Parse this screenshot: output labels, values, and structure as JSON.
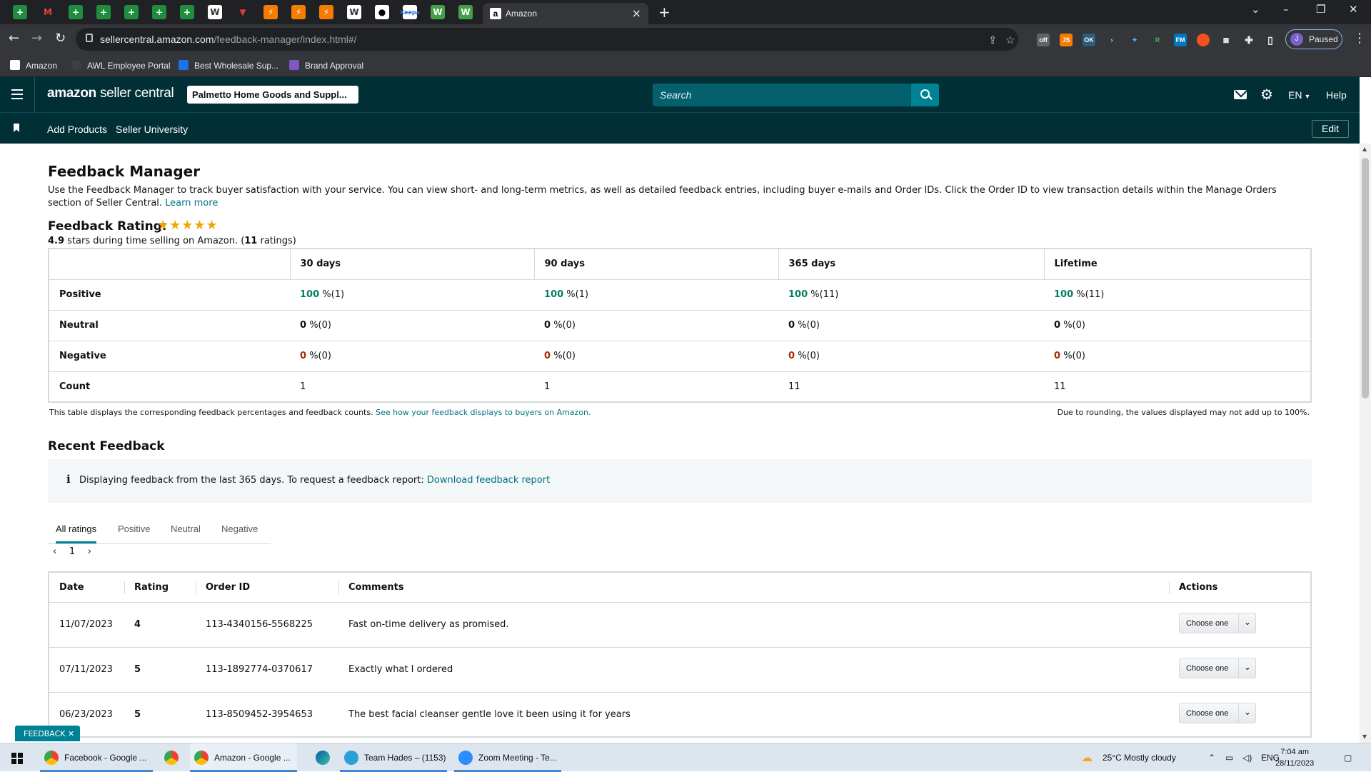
{
  "browser": {
    "active_tab_title": "Amazon",
    "url_host": "sellercentral.amazon.com",
    "url_path": "/feedback-manager/index.html#/",
    "profile_status": "Paused",
    "profile_initial": "J",
    "bookmarks": [
      "Amazon",
      "AWL Employee Portal",
      "Best Wholesale Sup...",
      "Brand Approval"
    ]
  },
  "header": {
    "logo_main": "amazon",
    "logo_sub": "seller central",
    "account": "Palmetto Home Goods and Suppl...",
    "search_placeholder": "Search",
    "language": "EN",
    "help": "Help"
  },
  "subnav": {
    "links": [
      "Add Products",
      "Seller University"
    ],
    "edit": "Edit"
  },
  "page": {
    "title": "Feedback Manager",
    "intro": "Use the Feedback Manager to track buyer satisfaction with your service. You can view short- and long-term metrics, as well as detailed feedback entries, including buyer e-mails and Order IDs. Click the Order ID to view transaction details within the Manage Orders section of Seller Central.",
    "learn_more": "Learn more",
    "rating_title": "Feedback Rating:",
    "rating_stars": "★★★★★",
    "rating_score": "4.9",
    "rating_sub_a": "stars during time selling on Amazon. (",
    "rating_count": "11",
    "rating_sub_b": "ratings)"
  },
  "summary": {
    "columns": [
      "30 days",
      "90 days",
      "365 days",
      "Lifetime"
    ],
    "rows": [
      {
        "label": "Positive",
        "values": [
          [
            "100",
            "%(1)"
          ],
          [
            "100",
            "%(1)"
          ],
          [
            "100",
            "%(11)"
          ],
          [
            "100",
            "%(11)"
          ]
        ]
      },
      {
        "label": "Neutral",
        "values": [
          [
            "0",
            "%(0)"
          ],
          [
            "0",
            "%(0)"
          ],
          [
            "0",
            "%(0)"
          ],
          [
            "0",
            "%(0)"
          ]
        ]
      },
      {
        "label": "Negative",
        "values": [
          [
            "0",
            "%(0)"
          ],
          [
            "0",
            "%(0)"
          ],
          [
            "0",
            "%(0)"
          ],
          [
            "0",
            "%(0)"
          ]
        ]
      },
      {
        "label": "Count",
        "values": [
          [
            "1"
          ],
          [
            "1"
          ],
          [
            "11"
          ],
          [
            "11"
          ]
        ]
      }
    ],
    "footnote_left": "This table displays the corresponding feedback percentages and feedback counts.",
    "footnote_link": "See how your feedback displays to buyers on Amazon.",
    "footnote_right": "Due to rounding, the values displayed may not add up to 100%."
  },
  "recent": {
    "title": "Recent Feedback",
    "info_icon": "i",
    "info_text": "Displaying feedback from the last 365 days. To request a feedback report:",
    "info_link": "Download feedback report",
    "tabs": [
      "All ratings",
      "Positive",
      "Neutral",
      "Negative"
    ],
    "page_number": "1",
    "columns": [
      "Date",
      "Rating",
      "Order ID",
      "Comments",
      "Actions"
    ],
    "rows": [
      {
        "date": "11/07/2023",
        "rating": "4",
        "order_id": "113-4340156-5568225",
        "comment": "Fast on-time delivery as promised.",
        "action": "Choose one"
      },
      {
        "date": "07/11/2023",
        "rating": "5",
        "order_id": "113-1892774-0370617",
        "comment": "Exactly what I ordered",
        "action": "Choose one"
      },
      {
        "date": "06/23/2023",
        "rating": "5",
        "order_id": "113-8509452-3954653",
        "comment": "The best facial cleanser gentle love it been using it for years",
        "action": "Choose one"
      }
    ],
    "feedback_tab": "FEEDBACK ✕"
  },
  "taskbar": {
    "items": [
      "Facebook - Google ...",
      "Amazon - Google ...",
      "Team Hades – (1153)",
      "Zoom Meeting - Te..."
    ],
    "weather": "25°C  Mostly cloudy",
    "lang": "ENG",
    "time": "7:04 am",
    "date": "28/11/2023"
  },
  "colors": {
    "header_bg": "#002f36",
    "link": "#007185",
    "positive": "#067d62",
    "negative": "#b12704",
    "star": "#f0a500"
  }
}
